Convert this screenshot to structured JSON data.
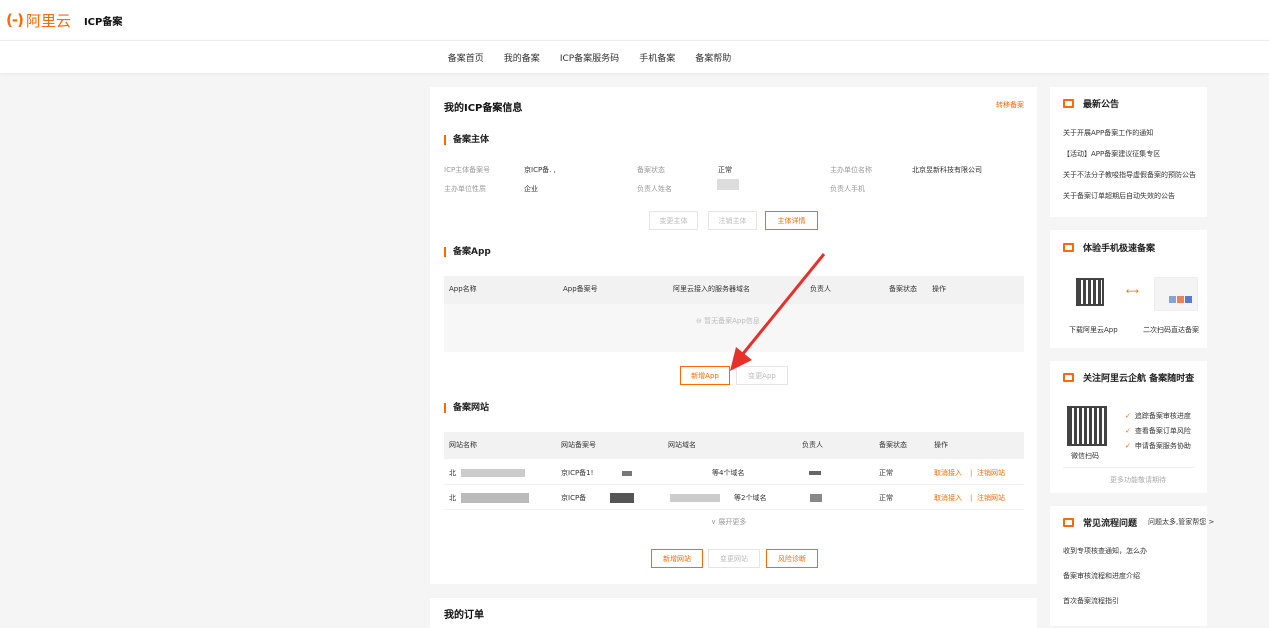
{
  "header": {
    "logo_mark": "(-)",
    "logo_text": "阿里云",
    "product": "ICP备案"
  },
  "nav": [
    "备案首页",
    "我的备案",
    "ICP备案服务码",
    "手机备案",
    "备案帮助"
  ],
  "main": {
    "title": "我的ICP备案信息",
    "transfer_link": "转移备案",
    "subject": {
      "section_title": "备案主体",
      "fields": [
        {
          "label": "ICP主体备案号",
          "value": "京ICP备.            ,"
        },
        {
          "label": "备案状态",
          "value": "正常"
        },
        {
          "label": "主办单位名称",
          "value": "北京昱新科技有限公司"
        },
        {
          "label": "主办单位性质",
          "value": "企业"
        },
        {
          "label": "负责人姓名",
          "value": ""
        },
        {
          "label": "负责人手机",
          "value": ""
        }
      ],
      "buttons": [
        "变更主体",
        "注销主体",
        "主体详情"
      ]
    },
    "app": {
      "section_title": "备案App",
      "columns": [
        "App名称",
        "App备案号",
        "阿里云接入的服务器域名",
        "负责人",
        "备案状态",
        "操作"
      ],
      "empty_text": "暂无备案App信息",
      "buttons": [
        "新增App",
        "变更App"
      ]
    },
    "website": {
      "section_title": "备案网站",
      "columns": [
        "网站名称",
        "网站备案号",
        "网站域名",
        "负责人",
        "备案状态",
        "操作"
      ],
      "rows": [
        {
          "name": "北",
          "record": "京ICP备1!",
          "domain": "等4个域名",
          "status": "正常",
          "cancel": "取消接入",
          "sep": "|",
          "logout": "注销网站"
        },
        {
          "name": "北",
          "record": "京ICP备",
          "domain": "等2个域名",
          "status": "正常",
          "cancel": "取消接入",
          "sep": "|",
          "logout": "注销网站"
        }
      ],
      "expand": "展开更多",
      "buttons": [
        "新增网站",
        "变更网站",
        "风险诊断"
      ]
    },
    "orders_title": "我的订单"
  },
  "sidebar": {
    "announcements": {
      "title": "最新公告",
      "items": [
        "关于开展APP备案工作的通知",
        "【活动】APP备案建议征集专区",
        "关于不法分子教唆指导虚假备案的预防公告",
        "关于备案订单超期后自动失效的公告"
      ]
    },
    "mobile": {
      "title": "体验手机极速备案",
      "download": "下载阿里云App",
      "scan": "二次扫码直达备案"
    },
    "follow": {
      "title": "关注阿里云企航 备案随时查",
      "checks": [
        "追踪备案审核进度",
        "查看备案订单风险",
        "申请备案服务协助"
      ],
      "wechat": "微信扫码",
      "more": "更多功能敬请期待"
    },
    "faq": {
      "title": "常见流程问题",
      "hint": "问题太多,管家帮您 >",
      "items": [
        "收到专项核查通知，怎么办",
        "备案审核流程和进度介绍",
        "首次备案流程指引"
      ]
    }
  },
  "colors": {
    "accent": "#ff6a00",
    "arrow": "#e8302a"
  }
}
